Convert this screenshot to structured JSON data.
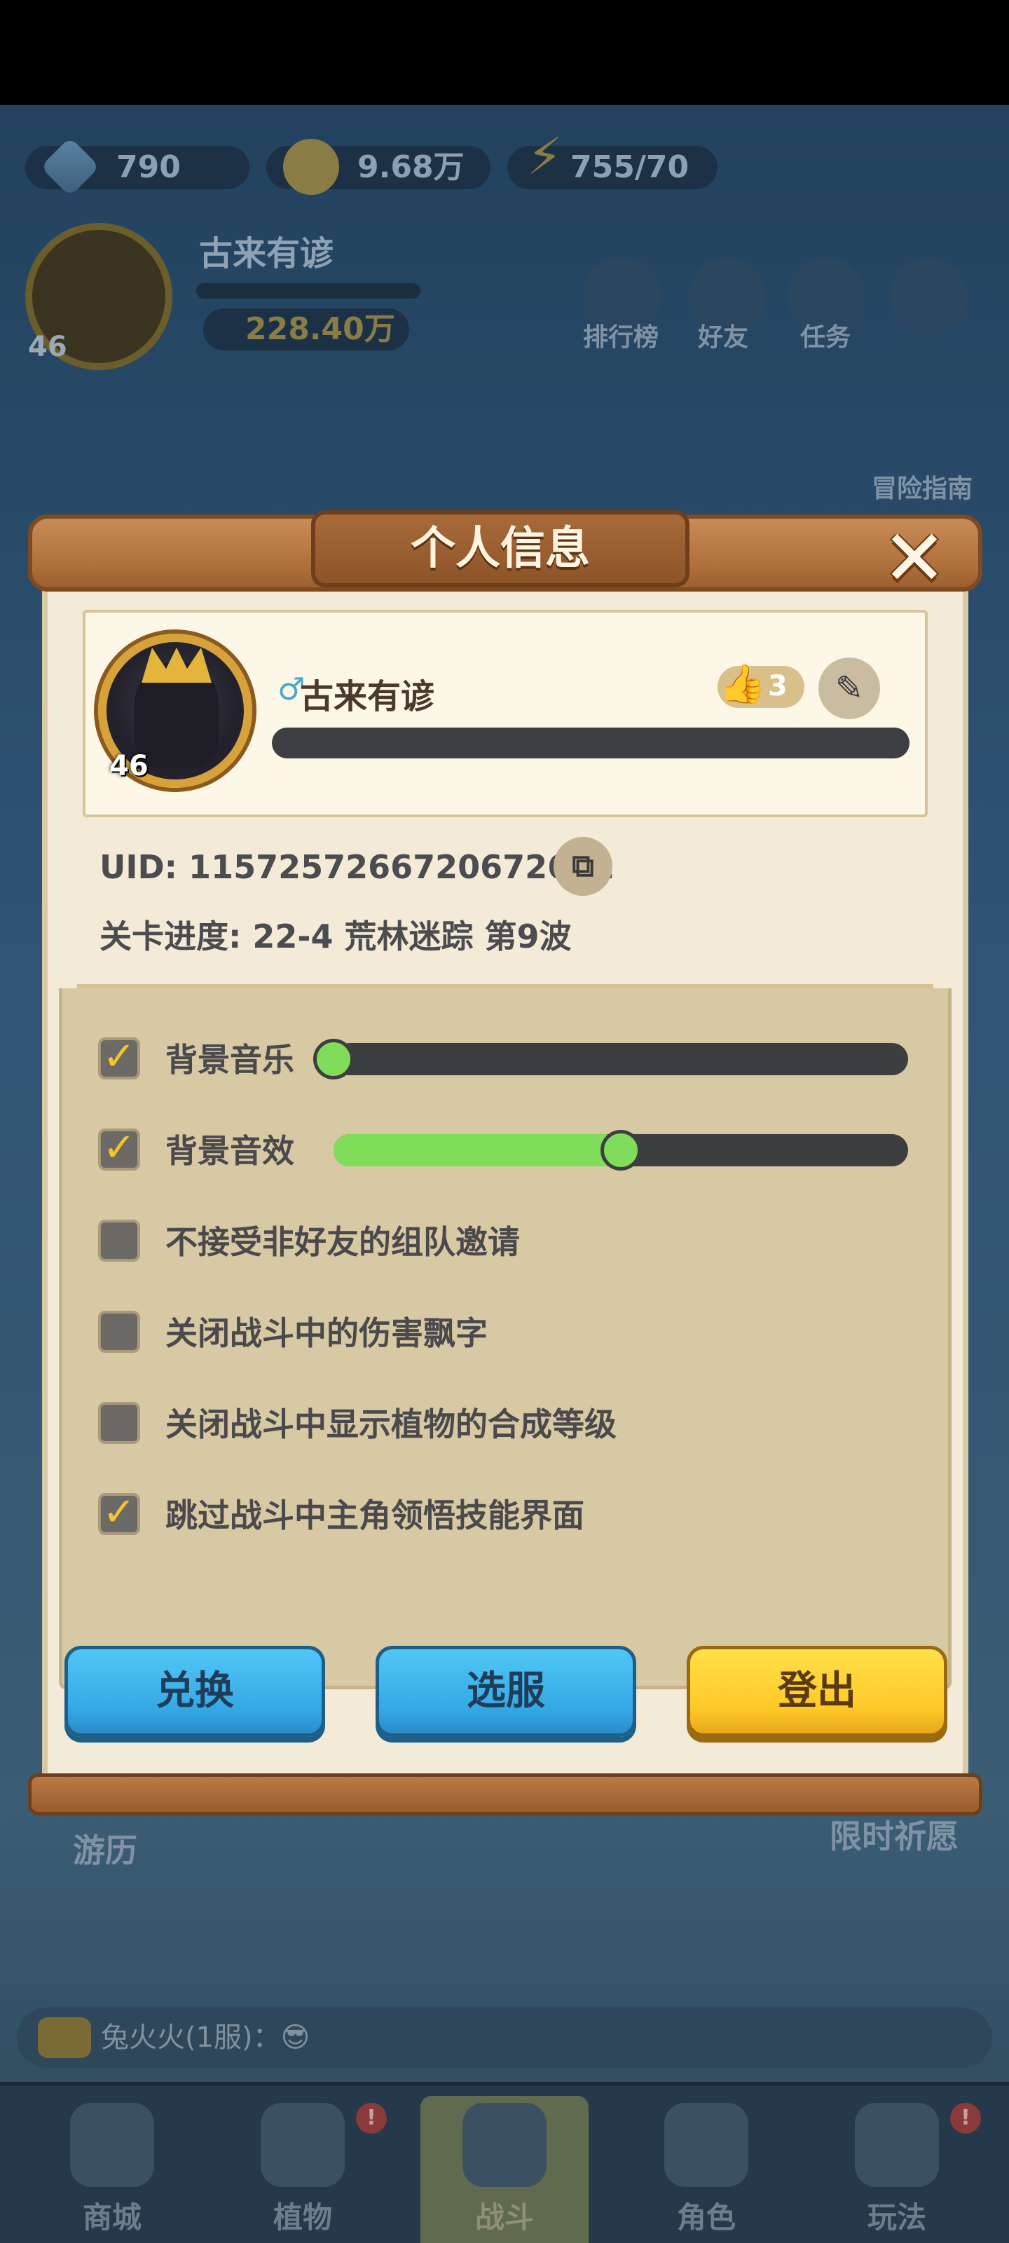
{
  "resources": {
    "diamonds": "790",
    "gold": "9.68万",
    "stamina": "755/70"
  },
  "background": {
    "player_name": "古来有谚",
    "player_level": "46",
    "gold_power": "228.40万",
    "nav": [
      "排行榜",
      "好友",
      "任务"
    ],
    "side_guide": "冒险指南",
    "side_tour": "游历",
    "side_wish": "限时祈愿",
    "chat_text": "兔火火(1服)：😎",
    "tabs": [
      "商城",
      "植物",
      "战斗",
      "角色",
      "玩法"
    ],
    "badge": "!"
  },
  "modal": {
    "title": "个人信息",
    "close_glyph": "✕",
    "profile": {
      "name": "古来有谚",
      "level": "46",
      "gender_glyph": "♂",
      "likes": "3",
      "like_glyph": "👍",
      "edit_glyph": "✎"
    },
    "uid": "UID: 1157257266720672622",
    "copy_glyph": "⧉",
    "stage_progress": "关卡进度: 22-4  荒林迷踪 第9波",
    "settings": [
      {
        "label": "背景音乐",
        "checked": true,
        "slider": 0.0
      },
      {
        "label": "背景音效",
        "checked": true,
        "slider": 0.5
      },
      {
        "label": "不接受非好友的组队邀请",
        "checked": false
      },
      {
        "label": "关闭战斗中的伤害飘字",
        "checked": false
      },
      {
        "label": "关闭战斗中显示植物的合成等级",
        "checked": false
      },
      {
        "label": "跳过战斗中主角领悟技能界面",
        "checked": true
      }
    ],
    "check_glyph": "✓",
    "buttons": {
      "redeem": "兑换",
      "server": "选服",
      "logout": "登出"
    }
  },
  "colors": {
    "accent_green": "#7fdd5a",
    "button_blue": "#35a9e6",
    "button_yellow": "#ffc928",
    "wood": "#b3743f"
  }
}
